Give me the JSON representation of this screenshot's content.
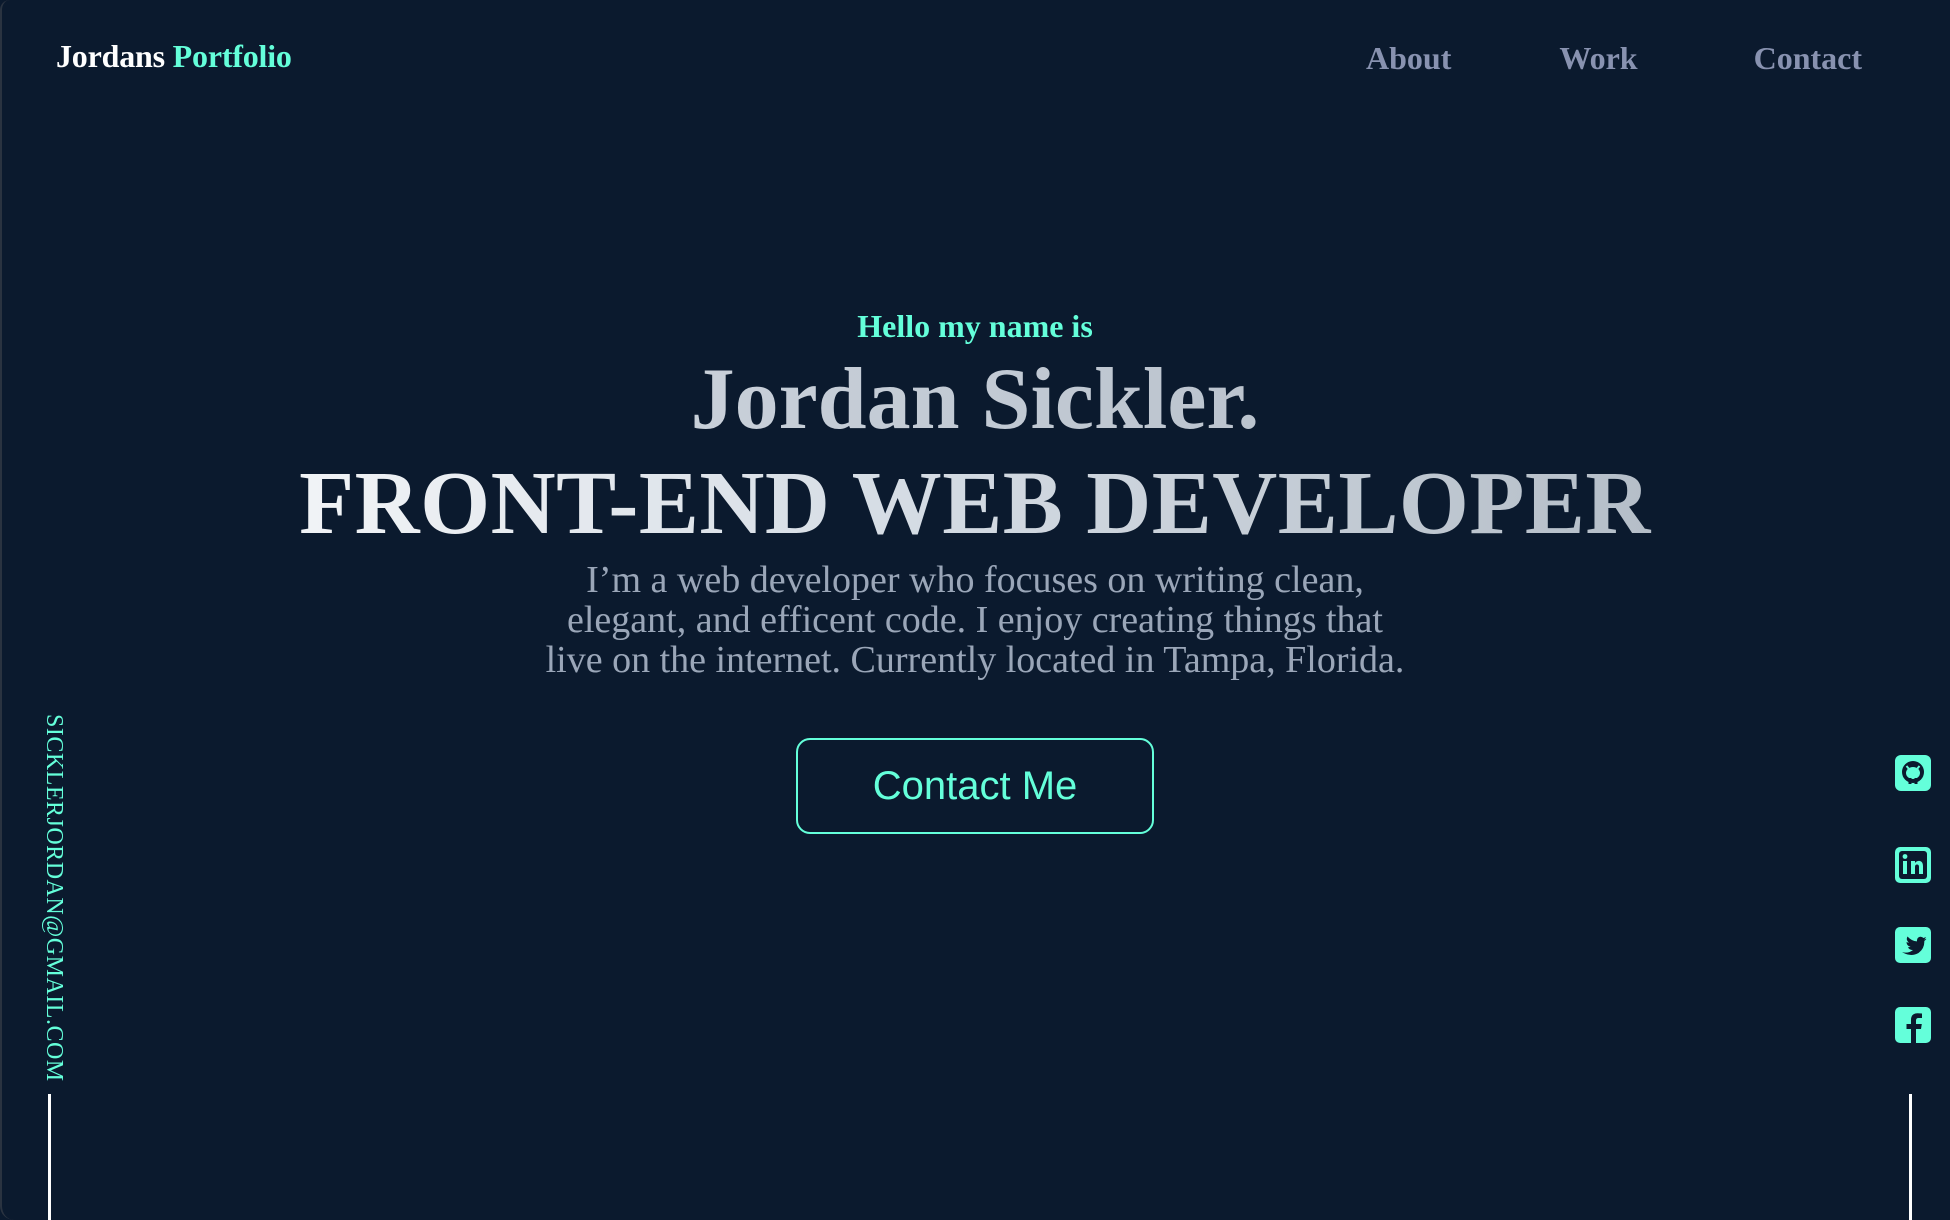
{
  "header": {
    "brand_first": "Jordans",
    "brand_second": "Portfolio",
    "nav": {
      "about": "About",
      "work": "Work",
      "contact": "Contact"
    }
  },
  "hero": {
    "greeting": "Hello my name is",
    "name": "Jordan Sickler.",
    "role": "FRONT-END WEB DEVELOPER",
    "bio_line1": "I’m a web developer who focuses on writing clean,",
    "bio_line2": "elegant, and efficent code. I enjoy creating things that",
    "bio_line3": "live on the internet. Currently located in Tampa, Florida.",
    "cta_label": "Contact Me"
  },
  "email_rail": {
    "email": "SICKLERJORDAN@GMAIL.COM"
  },
  "social_rail": {
    "icons": [
      "github-icon",
      "linkedin-icon",
      "twitter-icon",
      "facebook-icon"
    ]
  },
  "colors": {
    "background": "#0b1a2e",
    "accent": "#64ffda",
    "nav_text": "#8892b0",
    "body_text": "#9aa6b8",
    "rail_line": "#ffffff"
  }
}
